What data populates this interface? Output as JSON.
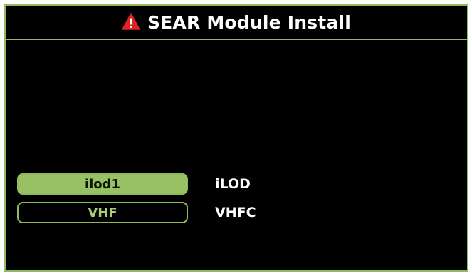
{
  "window": {
    "title": "SEAR Module Install",
    "title_icon": "warning-triangle-icon"
  },
  "modules": [
    {
      "button_label": "ilod1",
      "description": "iLOD",
      "selected": true
    },
    {
      "button_label": "VHF",
      "description": "VHFC",
      "selected": false
    }
  ],
  "colors": {
    "accent": "#8fbb5c",
    "button_active_fill": "#98c163",
    "warning": "#e02222",
    "background": "#000000"
  }
}
